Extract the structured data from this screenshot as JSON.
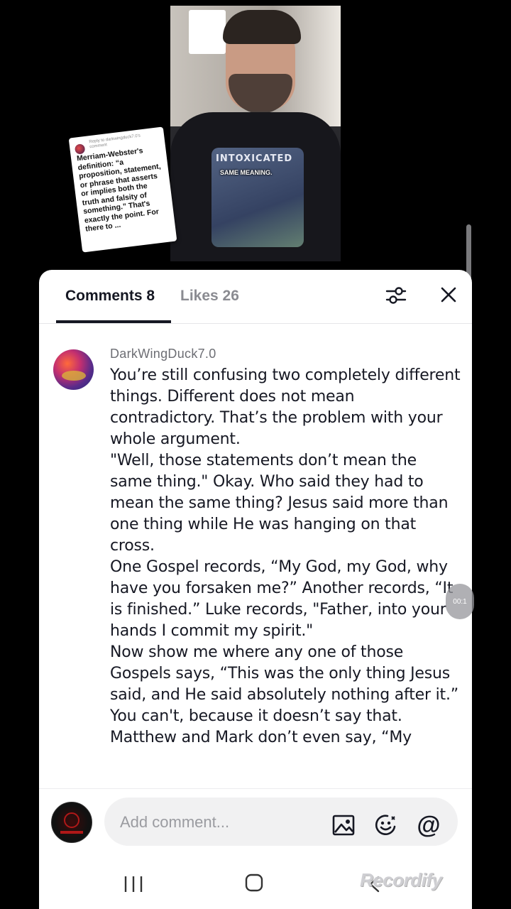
{
  "video": {
    "caption": "SAME MEANING.",
    "shirt_text": "INTOXICATED"
  },
  "sticker": {
    "reply_to": "Reply to darkwingduck7.0's comment",
    "text": "Merriam-Webster's definition: “a proposition, statement, or phrase that asserts or implies both the truth and falsity of something.” That's exactly the point. For there to ..."
  },
  "tabs": {
    "comments_label": "Comments 8",
    "likes_label": "Likes 26"
  },
  "comment": {
    "username": "DarkWingDuck7.0",
    "paragraphs": [
      "You’re still confusing two completely different things. Different does not mean contradictory. That’s the problem with your whole argument.",
      "\"Well, those statements don’t mean the same thing.\" Okay. Who said they had to mean the same thing? Jesus said more than one thing while He was hanging on that cross.",
      "One Gospel records, “My God, my God, why have you forsaken me?” Another records, “It is finished.” Luke records, \"Father, into your hands I commit my spirit.\"",
      "Now show me where any one of those Gospels says, “This was the only thing Jesus said, and He said absolutely nothing after it.” You can't, because it doesn’t say that.",
      "Matthew and Mark don’t even say, “My"
    ]
  },
  "composer": {
    "placeholder": "Add comment...",
    "mention_symbol": "@"
  },
  "overlay": {
    "watermark": "Recordify",
    "timer": "00:1"
  },
  "icons": {
    "filter": "sliders-icon",
    "close": "close-icon",
    "image": "image-icon",
    "emoji": "emoji-icon",
    "mention": "at-icon"
  }
}
